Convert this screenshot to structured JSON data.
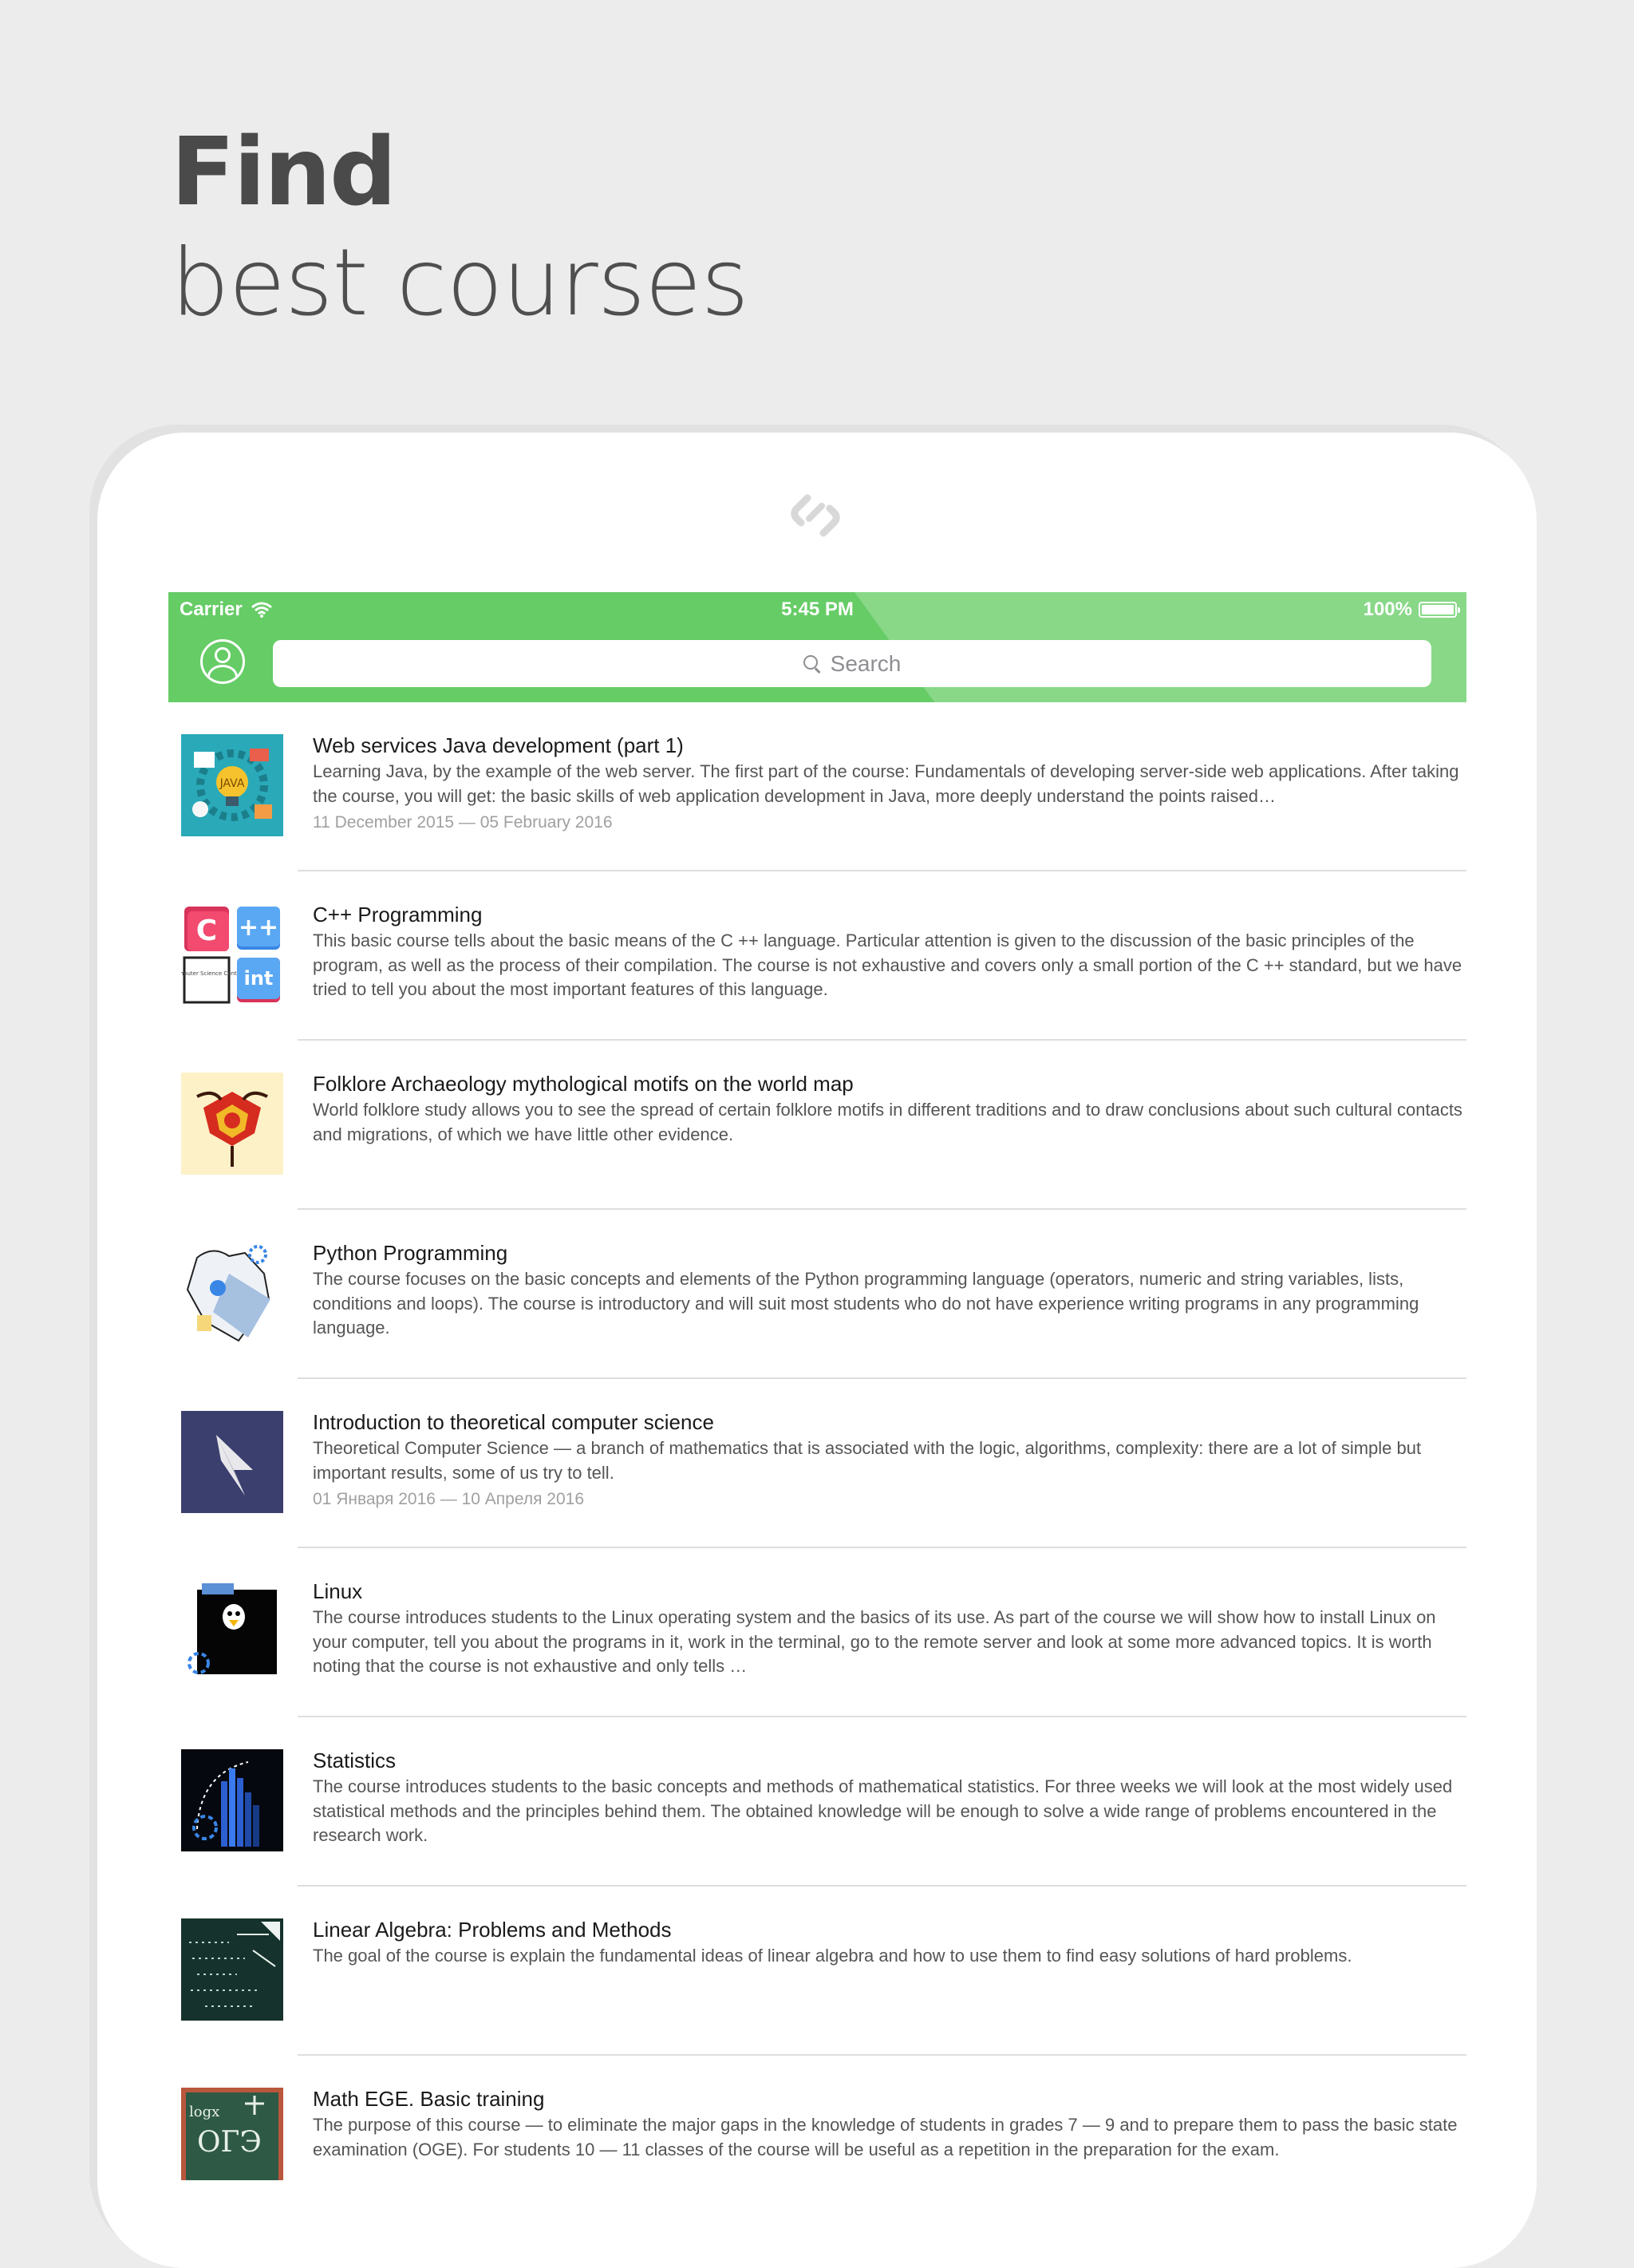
{
  "headline": {
    "line1": "Find",
    "line2": "best courses"
  },
  "status": {
    "carrier": "Carrier",
    "time": "5:45 PM",
    "battery": "100%"
  },
  "search": {
    "placeholder": "Search"
  },
  "colors": {
    "accent": "#66cc66",
    "accent_light": "#88d888"
  },
  "courses": [
    {
      "title": "Web services Java development (part 1)",
      "desc": "Learning Java, by the example of the web server. The first part of the course: Fundamentals of developing server-side web applications. After taking the course, you will get: the basic skills of web application development in Java, more deeply understand the points raised…",
      "date": "11 December 2015 — 05 February 2016",
      "icon": "java-icon"
    },
    {
      "title": "C++ Programming",
      "desc": "This basic course tells about the basic means of the C ++ language. Particular attention is given to the discussion of the basic principles of the program, as well as the process of their compilation. The course is not exhaustive and covers only a small portion of the C ++ standard, but we have tried to tell you about the most important features of this language.",
      "date": "",
      "icon": "cpp-icon",
      "thumb_labels": {
        "c": "C",
        "pp": "++",
        "csc": "Computer Science Center",
        "int": "int"
      }
    },
    {
      "title": "Folklore Archaeology mythological motifs on the world map",
      "desc": "World folklore study allows you to see the spread of certain folklore motifs in different traditions and to draw conclusions about such cultural contacts and migrations, of which we have little other evidence.",
      "date": "",
      "icon": "folklore-icon"
    },
    {
      "title": "Python Programming",
      "desc": "The course focuses on the basic concepts and elements of the Python programming language (operators, numeric and string variables, lists, conditions and loops). The course is introductory and will suit most students who do not have experience writing programs in any programming language.",
      "date": "",
      "icon": "python-icon"
    },
    {
      "title": "Introduction to theoretical computer science",
      "desc": "Theoretical Computer Science — a branch of mathematics that is associated with the logic, algorithms, complexity: there are a lot of simple but important results, some of us try to tell.",
      "date": "01 Января 2016 — 10 Апреля 2016",
      "icon": "cursor-icon"
    },
    {
      "title": "Linux",
      "desc": "The course introduces students to the Linux operating system and the basics of its use. As part of the course we will show how to install Linux on your computer, tell you about the programs in it, work in the terminal, go to the remote server and look at some more advanced topics. It is worth noting that the course is not exhaustive and only tells …",
      "date": "",
      "icon": "linux-icon"
    },
    {
      "title": "Statistics",
      "desc": "The course introduces students to the basic concepts and methods of mathematical statistics. For three weeks we will look at the most widely used statistical methods and the principles behind them. The obtained knowledge will be enough to solve a wide range of problems encountered in the research work.",
      "date": "",
      "icon": "statistics-icon"
    },
    {
      "title": "Linear Algebra: Problems and Methods",
      "desc": "The goal of the course is explain the fundamental ideas of linear algebra and how to use them to find easy solutions of hard problems.",
      "date": "",
      "icon": "linear-algebra-icon"
    },
    {
      "title": "Math EGE. Basic training",
      "desc": "The purpose of this course — to eliminate the major gaps in the knowledge of students in grades 7 — 9 and to prepare them to pass the basic state examination (OGE). For students 10 — 11 classes of the course will be useful as a repetition in the preparation for the exam.",
      "date": "",
      "icon": "math-ege-icon",
      "thumb_labels": {
        "log": "logx",
        "oge": "ОГЭ"
      }
    }
  ]
}
